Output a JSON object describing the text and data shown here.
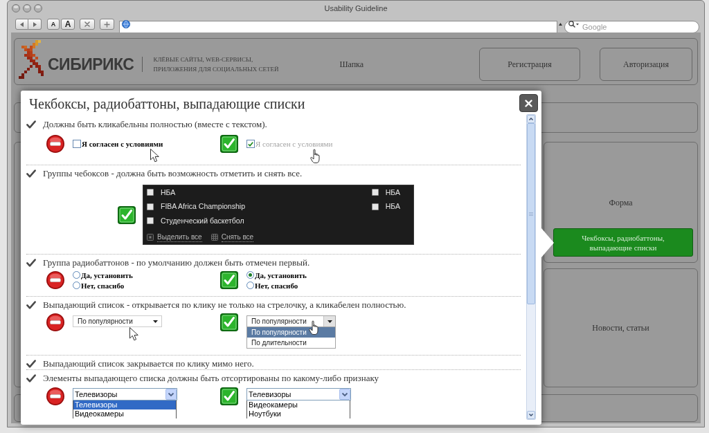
{
  "window": {
    "title": "Usability Guideline"
  },
  "toolbar": {
    "text_buttons": [
      "A",
      "A"
    ],
    "search": {
      "placeholder": "Google"
    }
  },
  "page": {
    "header": {
      "logo": "СИБИРИКС",
      "tagline": "КЛЁВЫЕ САЙТЫ, WEB-СЕРВИСЫ, ПРИЛОЖЕНИЯ ДЛЯ СОЦИАЛЬНЫХ СЕТЕЙ",
      "label": "Шапка",
      "buttons": [
        "Регистрация",
        "Авторизация"
      ]
    },
    "form_block": {
      "label": "Форма",
      "sections": [
        {
          "label": "Чекбоксы, радиобаттоны, выпадающие списки",
          "selected": true
        }
      ]
    },
    "news_block": {
      "label": "Новости, статьи"
    }
  },
  "modal": {
    "title": "Чекбоксы, радиобаттоны, выпадающие списки",
    "rules": [
      {
        "text": "Должны быть кликабельны полностью (вместе с текстом).",
        "examples": [
          {
            "correct": false,
            "kind": "checkbox",
            "label": "Я согласен с условиями",
            "checked": false,
            "dimmed": false,
            "hovered": true
          },
          {
            "correct": true,
            "kind": "checkbox",
            "label": "Я согласен с условиями",
            "checked": true,
            "dimmed": true,
            "hovered": true
          }
        ]
      },
      {
        "text": "Группы чебоксов - должна быть возможность отметить и снять все.",
        "examples": [
          {
            "correct": true,
            "kind": "checkbox_group",
            "columns": [
              {
                "items": [
                  {
                    "label": "НБА",
                    "checked": false
                  },
                  {
                    "label": "FIBA Africa Championship",
                    "checked": false
                  },
                  {
                    "label": "Студенческий баскетбол",
                    "checked": false
                  }
                ]
              },
              {
                "items": [
                  {
                    "label": "НБА",
                    "checked": false
                  },
                  {
                    "label": "НБА",
                    "checked": false
                  }
                ]
              }
            ],
            "actions": [
              "Выделить все",
              "Снять все"
            ]
          }
        ]
      },
      {
        "text": "Группа радиобаттонов - по умолчанию должен быть отмечен первый.",
        "examples": [
          {
            "correct": false,
            "kind": "radio",
            "options": [
              {
                "label": "Да, установить",
                "selected": false
              },
              {
                "label": "Нет, спасибо",
                "selected": false
              }
            ]
          },
          {
            "correct": true,
            "kind": "radio",
            "options": [
              {
                "label": "Да, установить",
                "selected": true
              },
              {
                "label": "Нет, спасибо",
                "selected": false
              }
            ]
          }
        ]
      },
      {
        "text": "Выпадающий список - открывается по клику не только на стрелочку, а кликабелен полностью.",
        "examples": [
          {
            "correct": false,
            "kind": "select",
            "value": "По популярности",
            "expanded": false,
            "hovered": true
          },
          {
            "correct": true,
            "kind": "select",
            "value": "По популярности",
            "expanded": true,
            "options": [
              {
                "label": "По популярности",
                "selected": true
              },
              {
                "label": "По длительности",
                "selected": false
              }
            ],
            "hovered": true
          }
        ]
      },
      {
        "text": "Выпадающий список закрывается по клику мимо него."
      },
      {
        "text": "Элементы выпадающего списка должны быть отсортированы по какому-либо признаку",
        "examples": [
          {
            "correct": false,
            "kind": "listbox",
            "value": "Телевизоры",
            "options": [
              {
                "label": "Телевизоры",
                "selected": true
              },
              {
                "label": "Видеокамеры",
                "selected": false
              }
            ]
          },
          {
            "correct": true,
            "kind": "listbox",
            "value": "Телевизоры",
            "options": [
              {
                "label": "Видеокамеры",
                "selected": false
              },
              {
                "label": "Ноутбуки",
                "selected": false
              }
            ]
          }
        ]
      }
    ]
  }
}
